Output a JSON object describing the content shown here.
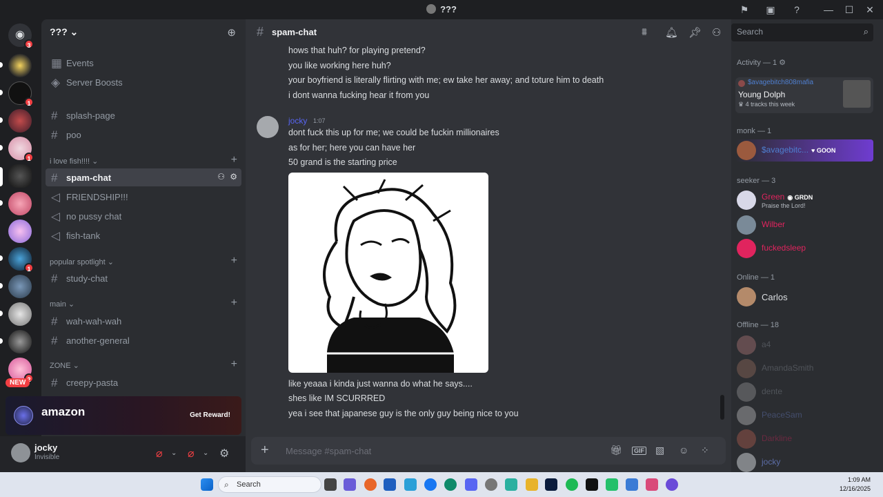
{
  "window": {
    "title": "???"
  },
  "server": {
    "name": "??? ⌄"
  },
  "rail": {
    "dm_badge": "3",
    "new_label": "NEW",
    "badges": [
      "1",
      "1",
      "1",
      "2",
      "2"
    ]
  },
  "sidebar": {
    "top_items": [
      {
        "label": "Events"
      },
      {
        "label": "Server Boosts"
      }
    ],
    "channels_a": [
      "splash-page",
      "poo"
    ],
    "category_fish": "i love fish!!!! ⌄",
    "fish_channels": [
      "spam-chat",
      "FRIENDSHIP!!!",
      "no pussy chat",
      "fish-tank"
    ],
    "category_popular": "popular spotlight ⌄",
    "popular_channels": [
      "study-chat"
    ],
    "category_main": "main ⌄",
    "main_channels": [
      "wah-wah-wah",
      "another-general"
    ],
    "category_zone": "ZONE ⌄",
    "zone_channels": [
      "creepy-pasta"
    ]
  },
  "promo": {
    "brand": "amazon",
    "cta": "Get Reward!"
  },
  "user": {
    "name": "jocky",
    "status": "Invisible"
  },
  "channel": {
    "name": "spam-chat"
  },
  "messages": {
    "prev_lines": [
      "hows that huh? for playing pretend?",
      "you like working here huh?",
      "your boyfriend is literally flirting with me; ew take her away; and toture him to death",
      "i dont wanna fucking hear it from you"
    ],
    "author": "jocky",
    "timestamp": "1:07",
    "lines_before_image": [
      "dont fuck this up for me; we could be fuckin millionaires",
      "as for her; here you can have her",
      "50 grand is the starting price"
    ],
    "lines_after_image": [
      "like yeaaa i kinda just wanna do what he says....",
      "shes like IM SCURRRED",
      "yea i see that japanese guy is the only guy being nice to you"
    ]
  },
  "composer": {
    "placeholder": "Message #spam-chat",
    "gif": "GIF"
  },
  "members": {
    "search_placeholder": "Search",
    "activity_header": "Activity — 1",
    "activity": {
      "user": "$avagebitch808mafia",
      "title": "Young Dolph",
      "sub": "4 tracks this week"
    },
    "monk_header": "monk — 1",
    "monk": [
      {
        "name": "$avagebitc...",
        "tag": "GOON"
      }
    ],
    "seeker_header": "seeker — 3",
    "seekers": [
      {
        "name": "Green",
        "tag": "GRDN",
        "status": "Praise the Lord!",
        "color": "#e0245e"
      },
      {
        "name": "Wilber",
        "color": "#e0245e"
      },
      {
        "name": "fuckedsleep",
        "color": "#e0245e"
      }
    ],
    "online_header": "Online — 1",
    "online": [
      {
        "name": "Carlos"
      }
    ],
    "offline_header": "Offline — 18",
    "offline": [
      "a4",
      "AmandaSmith",
      "dente",
      "PeaceSam",
      "Darkline",
      "jocky"
    ]
  },
  "taskbar": {
    "search": "Search",
    "time": "1:09 AM",
    "date": "12/16/2025"
  },
  "colors": {
    "accent": "#5865f2",
    "bg": "#313338",
    "sidebar": "#2b2d31"
  }
}
